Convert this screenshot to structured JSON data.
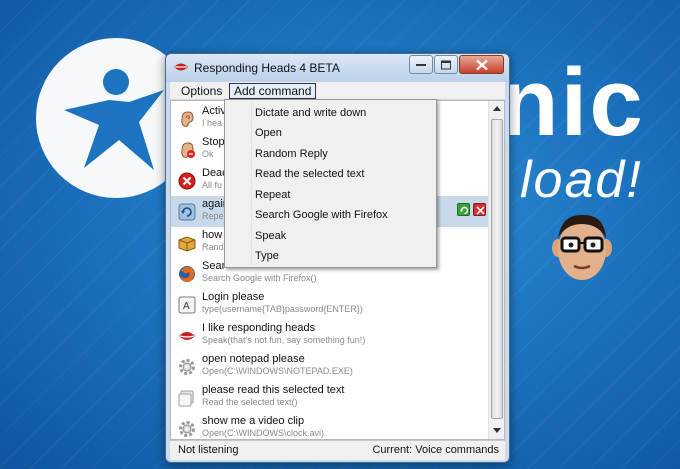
{
  "window": {
    "title": "Responding Heads 4 BETA"
  },
  "menu": {
    "options_label": "Options",
    "add_command_label": "Add command"
  },
  "dropdown": {
    "items": [
      "Dictate and write down",
      "Open",
      "Random Reply",
      "Read the selected text",
      "Repeat",
      "Search Google with Firefox",
      "Speak",
      "Type"
    ]
  },
  "commands": [
    {
      "title": "Activ",
      "sub": "I hea",
      "icon": "ear-icon"
    },
    {
      "title": "Stop",
      "sub": "Ok",
      "icon": "ear-stop-icon"
    },
    {
      "title": "Deac",
      "sub": "All fu",
      "icon": "deactivate-icon"
    },
    {
      "title": "again",
      "sub": "Repe",
      "icon": "repeat-icon"
    },
    {
      "title": "how",
      "sub": "Rand",
      "icon": "box-icon"
    },
    {
      "title": "Sear",
      "sub": "Search Google with Firefox()",
      "icon": "firefox-icon"
    },
    {
      "title": "Login please",
      "sub": "type(username{TAB}password{ENTER})",
      "icon": "type-icon"
    },
    {
      "title": "I like responding heads",
      "sub": "Speak(that's not fun, say something fun!)",
      "icon": "lips-icon"
    },
    {
      "title": "open notepad please",
      "sub": "Open(C:\\WINDOWS\\NOTEPAD.EXE)",
      "icon": "gear-icon"
    },
    {
      "title": "please read this selected text",
      "sub": "Read the selected text()",
      "icon": "read-text-icon"
    },
    {
      "title": "show me a video clip",
      "sub": "Open(C:\\WINDOWS\\clock.avi)",
      "icon": "gear-icon"
    }
  ],
  "status": {
    "left": "Not listening",
    "right": "Current: Voice commands"
  },
  "background": {
    "word1": "nic",
    "word2": "load!"
  },
  "colors": {
    "desktop": "#1d74c0",
    "selected_row": "#c9d9ea",
    "menu_bg": "#f0f0f0"
  }
}
